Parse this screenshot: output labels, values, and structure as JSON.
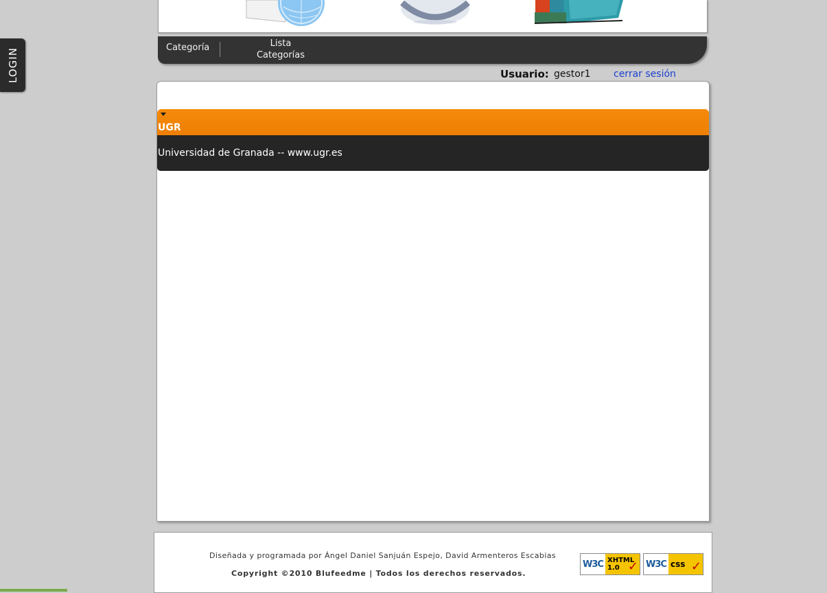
{
  "login_tab": {
    "label": "LOGIN"
  },
  "banner": {
    "icons": [
      "globe-document-icon",
      "disc-icon",
      "books-icon"
    ]
  },
  "nav": {
    "items": [
      {
        "label": "Categoría"
      },
      {
        "label_line1": "Lista",
        "label_line2": "Categorías"
      }
    ]
  },
  "user": {
    "label": "Usuario:",
    "name": "gestor1",
    "logout": "cerrar sesión"
  },
  "category": {
    "title": "UGR",
    "description": "Universidad de Granada -- www.ugr.es",
    "header_color": "#f08405",
    "body_color": "#252525"
  },
  "footer": {
    "credits": "Diseñada y programada por Ángel Daniel Sanjuán Espejo, David Armenteros Escabias",
    "copyright": "Copyright ©2010 Blufeedme | Todos los derechos reservados.",
    "badges": [
      {
        "w3c": "W3C",
        "kind": "XHTML",
        "version": "1.0"
      },
      {
        "w3c": "W3C",
        "kind": "css"
      }
    ]
  }
}
